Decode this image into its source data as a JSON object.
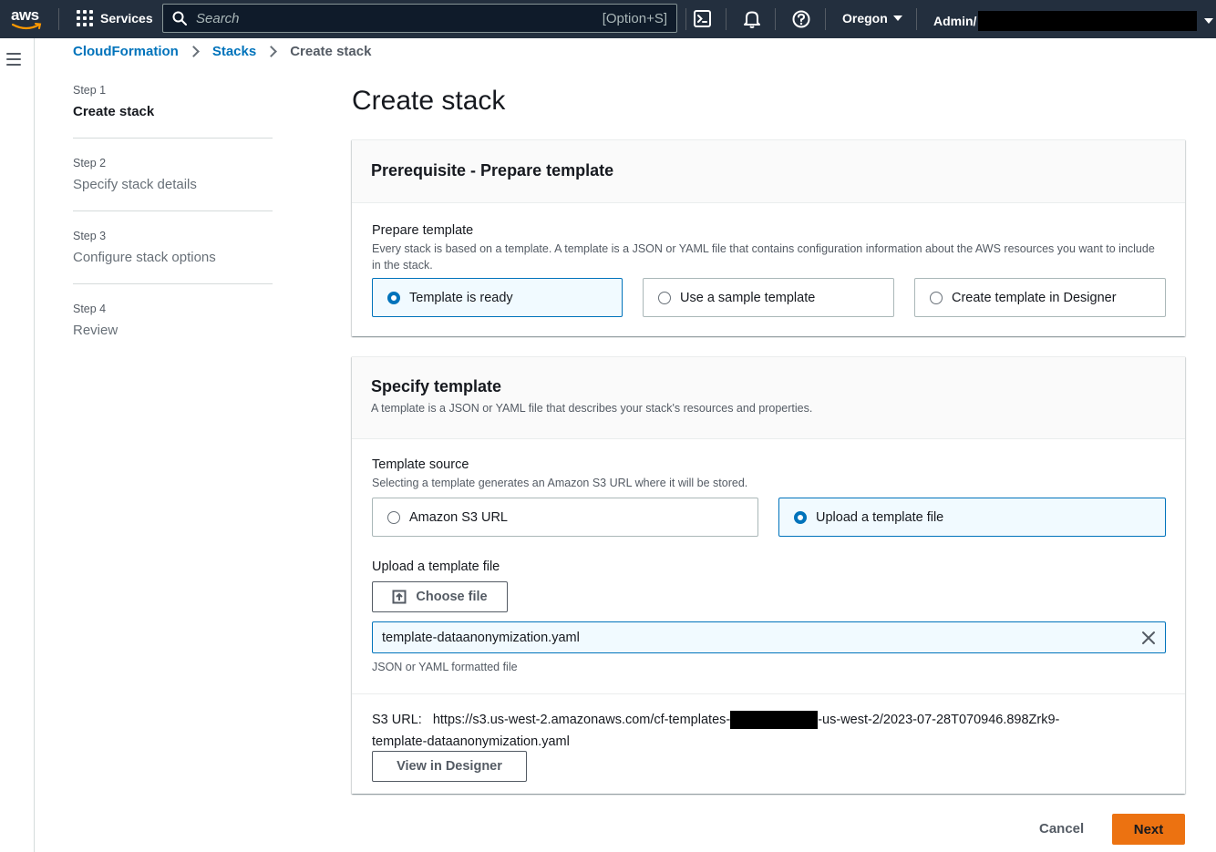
{
  "topnav": {
    "logo_text": "aws",
    "services_label": "Services",
    "search_placeholder": "Search",
    "search_shortcut": "[Option+S]",
    "region": "Oregon",
    "account": "Admin/"
  },
  "breadcrumb": {
    "items": [
      "CloudFormation",
      "Stacks",
      "Create stack"
    ]
  },
  "steps": [
    {
      "num": "Step 1",
      "title": "Create stack"
    },
    {
      "num": "Step 2",
      "title": "Specify stack details"
    },
    {
      "num": "Step 3",
      "title": "Configure stack options"
    },
    {
      "num": "Step 4",
      "title": "Review"
    }
  ],
  "page_title": "Create stack",
  "prereq": {
    "heading": "Prerequisite - Prepare template",
    "label": "Prepare template",
    "description": "Every stack is based on a template. A template is a JSON or YAML file that contains configuration information about the AWS resources you want to include in the stack.",
    "options": [
      "Template is ready",
      "Use a sample template",
      "Create template in Designer"
    ],
    "selected": "Template is ready"
  },
  "specify": {
    "heading": "Specify template",
    "description": "A template is a JSON or YAML file that describes your stack's resources and properties.",
    "source_label": "Template source",
    "source_description": "Selecting a template generates an Amazon S3 URL where it will be stored.",
    "sources": [
      "Amazon S3 URL",
      "Upload a template file"
    ],
    "selected_source": "Upload a template file",
    "upload_label": "Upload a template file",
    "choose_file_label": "Choose file",
    "file_name": "template-dataanonymization.yaml",
    "file_hint": "JSON or YAML formatted file",
    "s3_label": "S3 URL:",
    "s3_url_prefix": "https://s3.us-west-2.amazonaws.com/cf-templates-",
    "s3_url_suffix": "-us-west-2/2023-07-28T070946.898Zrk9-",
    "s3_url_line2": "template-dataanonymization.yaml",
    "view_designer_label": "View in Designer"
  },
  "footer": {
    "cancel_label": "Cancel",
    "next_label": "Next"
  },
  "colors": {
    "nav_bg": "#232f3e",
    "link": "#0073bb",
    "primary": "#ec7211",
    "selected_bg": "#f1faff"
  }
}
